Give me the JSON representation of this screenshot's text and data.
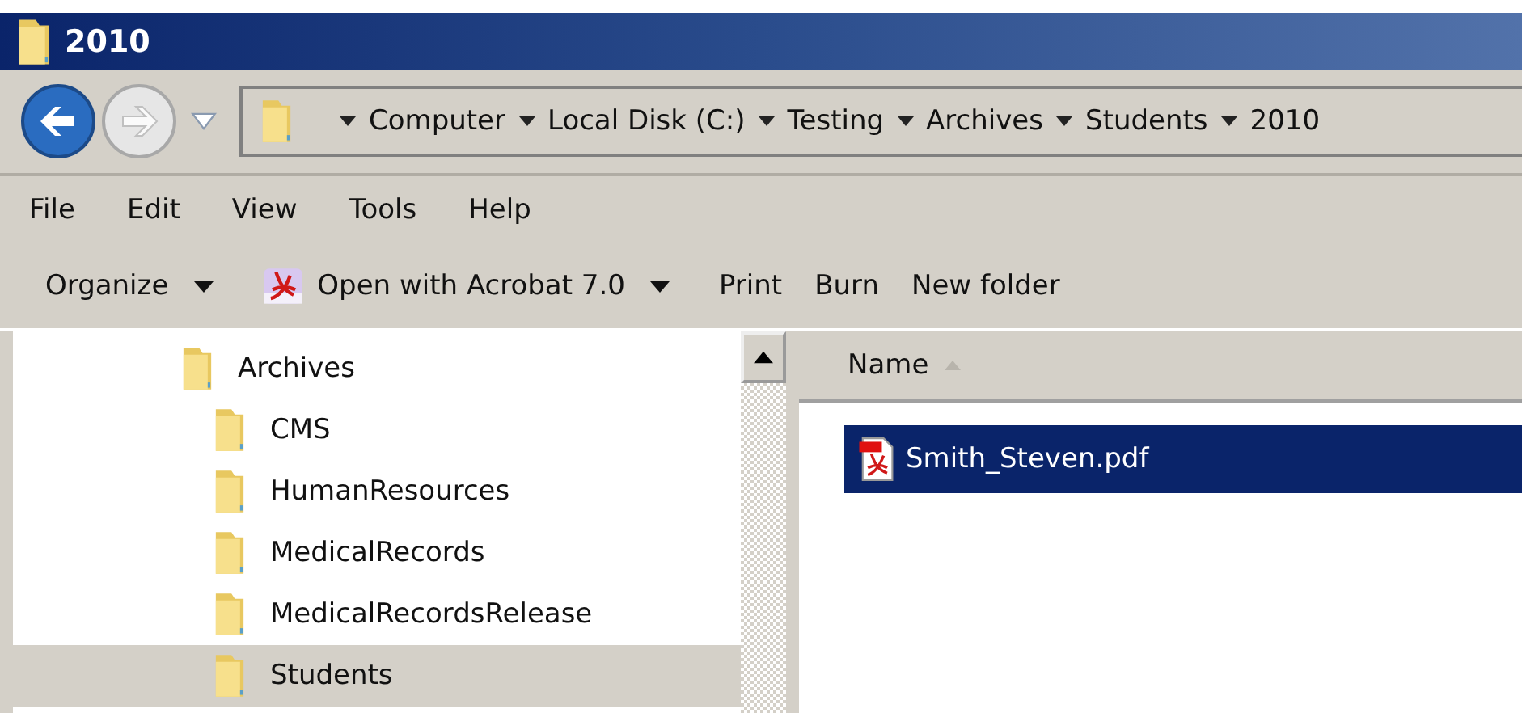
{
  "window": {
    "title": "2010"
  },
  "address_bar": {
    "breadcrumbs": [
      "Computer",
      "Local Disk (C:)",
      "Testing",
      "Archives",
      "Students",
      "2010"
    ]
  },
  "menu": [
    "File",
    "Edit",
    "View",
    "Tools",
    "Help"
  ],
  "toolbar": [
    {
      "label": "Organize",
      "kind": "dropdown"
    },
    {
      "label": "Open with Acrobat 7.0",
      "kind": "acrobat"
    },
    {
      "label": "Print",
      "kind": "plain"
    },
    {
      "label": "Burn",
      "kind": "plain"
    },
    {
      "label": "New folder",
      "kind": "plain"
    }
  ],
  "navigation_tree": [
    {
      "label": "Archives",
      "selected": false,
      "children": [
        {
          "label": "CMS",
          "selected": false
        },
        {
          "label": "HumanResources",
          "selected": false
        },
        {
          "label": "MedicalRecords",
          "selected": false
        },
        {
          "label": "MedicalRecordsRelease",
          "selected": false
        },
        {
          "label": "Students",
          "selected": true
        }
      ]
    }
  ],
  "file_list": {
    "columns": [
      "Name"
    ],
    "rows": [
      {
        "name": "Smith_Steven.pdf",
        "selected": true
      }
    ]
  }
}
